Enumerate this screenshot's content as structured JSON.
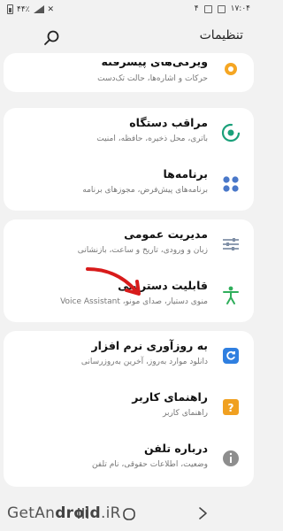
{
  "status_bar": {
    "time": "۱۷:۰۴",
    "battery": "۴۴٪",
    "notif_count": "۴"
  },
  "header": {
    "title": "تنظیمات"
  },
  "cards": [
    {
      "items": [
        {
          "title": "ویژگی‌های پیشرفته",
          "subtitle": "حرکات و اشاره‌ها، حالت تک‌دست",
          "icon": "advanced-features-icon",
          "color": "#f5a623"
        }
      ]
    },
    {
      "items": [
        {
          "title": "مراقب دستگاه",
          "subtitle": "باتری، محل ذخیره، حافظه، امنیت",
          "icon": "device-care-icon",
          "color": "#1aa07a"
        },
        {
          "title": "برنامه‌ها",
          "subtitle": "برنامه‌های پیش‌فرض، مجوزهای برنامه",
          "icon": "apps-icon",
          "color": "#4a78c9"
        }
      ]
    },
    {
      "items": [
        {
          "title": "مدیریت عمومی",
          "subtitle": "زبان و ورودی، تاریخ و ساعت، بازنشانی",
          "icon": "general-management-icon",
          "color": "#7f8fa6"
        },
        {
          "title": "قابلیت دسترسی",
          "subtitle": "منوی دستیار، صدای مونو، Voice Assistant",
          "icon": "accessibility-icon",
          "color": "#2fae5b"
        }
      ]
    },
    {
      "items": [
        {
          "title": "به روزآوری نرم افزار",
          "subtitle": "دانلود موارد به‌روز، آخرین به‌روزرسانی",
          "icon": "software-update-icon",
          "color": "#2f7fe0"
        },
        {
          "title": "راهنمای کاربر",
          "subtitle": "راهنمای کاربر",
          "icon": "user-manual-icon",
          "color": "#f0a020"
        },
        {
          "title": "درباره تلفن",
          "subtitle": "وضعیت، اطلاعات حقوقی، نام تلفن",
          "icon": "about-phone-icon",
          "color": "#8e8e8e"
        }
      ]
    }
  ],
  "watermark": {
    "prefix": "GetAn",
    "bold": "droid",
    "suffix": ".iR"
  },
  "annotation": {
    "arrow_color": "#d81b1b"
  }
}
